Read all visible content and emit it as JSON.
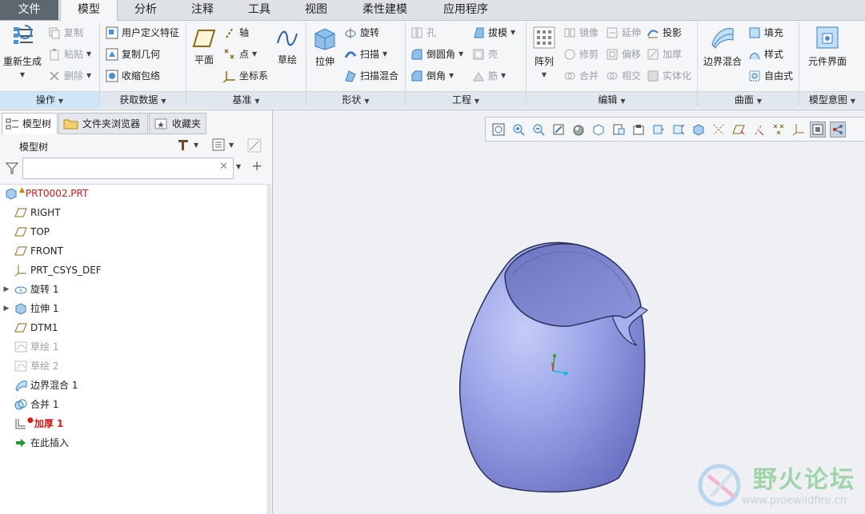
{
  "tabs": [
    "文件",
    "模型",
    "分析",
    "注释",
    "工具",
    "视图",
    "柔性建模",
    "应用程序"
  ],
  "active_tab": "模型",
  "ribbon": {
    "groups": [
      "操作",
      "获取数据",
      "基准",
      "形状",
      "工程",
      "编辑",
      "曲面",
      "模型意图"
    ],
    "operations": {
      "regenerate": "重新生成",
      "copy": "复制",
      "paste": "粘贴",
      "delete": "删除"
    },
    "get_data": {
      "udf": "用户定义特征",
      "copy_geom": "复制几何",
      "shrinkwrap": "收缩包络"
    },
    "datum": {
      "plane": "平面",
      "axis": "轴",
      "point": "点",
      "csys": "坐标系",
      "sketch": "草绘"
    },
    "shape": {
      "extrude": "拉伸",
      "revolve": "旋转",
      "sweep": "扫描",
      "swept_blend": "扫描混合"
    },
    "engineering": {
      "hole": "孔",
      "draft": "拔模",
      "round": "倒圆角",
      "shell": "壳",
      "chamfer": "倒角",
      "rib": "筋"
    },
    "editing": {
      "pattern": "阵列",
      "mirror": "镜像",
      "extend": "延伸",
      "project": "投影",
      "trim": "修剪",
      "offset": "偏移",
      "thicken": "加厚",
      "merge": "合并",
      "intersect": "相交",
      "solidify": "实体化"
    },
    "surfaces": {
      "boundary_blend": "边界混合",
      "fill": "填充",
      "style": "样式",
      "freestyle": "自由式"
    },
    "model_intent": {
      "component_interface": "元件界面"
    }
  },
  "panel": {
    "tabs": [
      "模型树",
      "文件夹浏览器",
      "收藏夹"
    ],
    "header": "模型树",
    "search_placeholder": ""
  },
  "tree": [
    {
      "label": "PRT0002.PRT",
      "icon": "part-icon",
      "state": "warning",
      "expand": false
    },
    {
      "label": "RIGHT",
      "icon": "datum-plane-icon",
      "state": "normal",
      "expand": false
    },
    {
      "label": "TOP",
      "icon": "datum-plane-icon",
      "state": "normal",
      "expand": false
    },
    {
      "label": "FRONT",
      "icon": "datum-plane-icon",
      "state": "normal",
      "expand": false
    },
    {
      "label": "PRT_CSYS_DEF",
      "icon": "csys-icon",
      "state": "normal",
      "expand": false
    },
    {
      "label": "旋转 1",
      "icon": "revolve-icon",
      "state": "normal",
      "expand": true
    },
    {
      "label": "拉伸 1",
      "icon": "extrude-icon",
      "state": "normal",
      "expand": true
    },
    {
      "label": "DTM1",
      "icon": "datum-plane-icon",
      "state": "normal",
      "expand": false
    },
    {
      "label": "草绘 1",
      "icon": "sketch-icon",
      "state": "suppressed",
      "expand": false
    },
    {
      "label": "草绘 2",
      "icon": "sketch-icon",
      "state": "suppressed",
      "expand": false
    },
    {
      "label": "边界混合 1",
      "icon": "boundary-blend-icon",
      "state": "normal",
      "expand": false
    },
    {
      "label": "合并 1",
      "icon": "merge-icon",
      "state": "normal",
      "expand": false
    },
    {
      "label": "加厚 1",
      "icon": "thicken-icon",
      "state": "error",
      "expand": false
    },
    {
      "label": "在此插入",
      "icon": "insert-here-icon",
      "state": "normal",
      "expand": false
    }
  ],
  "watermark": {
    "title": "野火论坛",
    "url": "www.proewildfire.cn"
  },
  "colors": {
    "model_body": "#9aa4e8",
    "model_dark": "#5c63a6",
    "error": "#d41919",
    "tab_active_bg": "#f4f6f8",
    "file_tab_bg": "#5e6670"
  }
}
